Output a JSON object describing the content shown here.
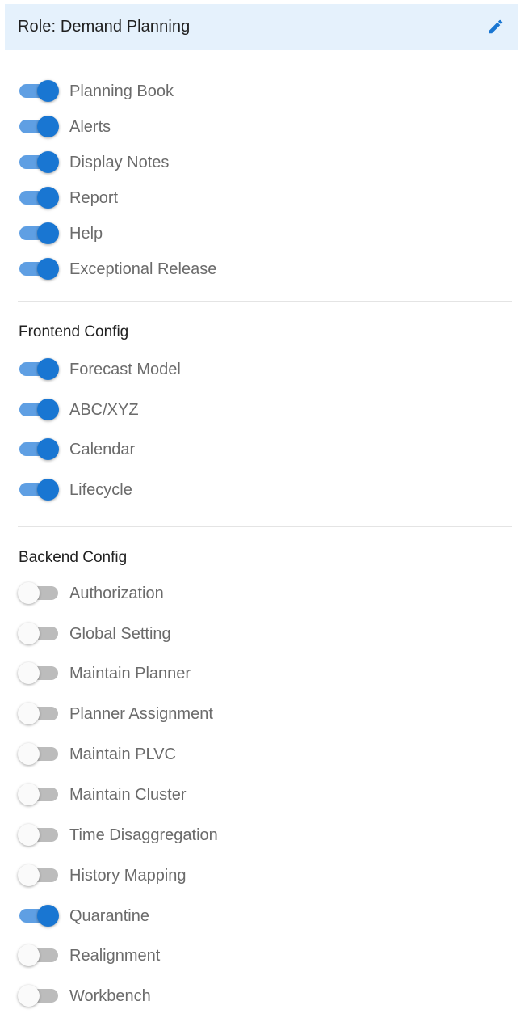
{
  "header": {
    "title": "Role: Demand Planning",
    "edit_icon": "pencil-icon",
    "accent_color": "#1976d2",
    "background_color": "#e5f1fc"
  },
  "general": {
    "toggles": [
      {
        "label": "Planning Book",
        "enabled": true
      },
      {
        "label": "Alerts",
        "enabled": true
      },
      {
        "label": "Display Notes",
        "enabled": true
      },
      {
        "label": "Report",
        "enabled": true
      },
      {
        "label": "Help",
        "enabled": true
      },
      {
        "label": "Exceptional Release",
        "enabled": true
      }
    ]
  },
  "frontend": {
    "title": "Frontend Config",
    "toggles": [
      {
        "label": "Forecast Model",
        "enabled": true
      },
      {
        "label": "ABC/XYZ",
        "enabled": true
      },
      {
        "label": "Calendar",
        "enabled": true
      },
      {
        "label": "Lifecycle",
        "enabled": true
      }
    ]
  },
  "backend": {
    "title": "Backend Config",
    "toggles": [
      {
        "label": "Authorization",
        "enabled": false
      },
      {
        "label": "Global Setting",
        "enabled": false
      },
      {
        "label": "Maintain Planner",
        "enabled": false
      },
      {
        "label": "Planner Assignment",
        "enabled": false
      },
      {
        "label": "Maintain PLVC",
        "enabled": false
      },
      {
        "label": "Maintain Cluster",
        "enabled": false
      },
      {
        "label": "Time Disaggregation",
        "enabled": false
      },
      {
        "label": "History Mapping",
        "enabled": false
      },
      {
        "label": "Quarantine",
        "enabled": true
      },
      {
        "label": "Realignment",
        "enabled": false
      },
      {
        "label": "Workbench",
        "enabled": false
      }
    ]
  }
}
